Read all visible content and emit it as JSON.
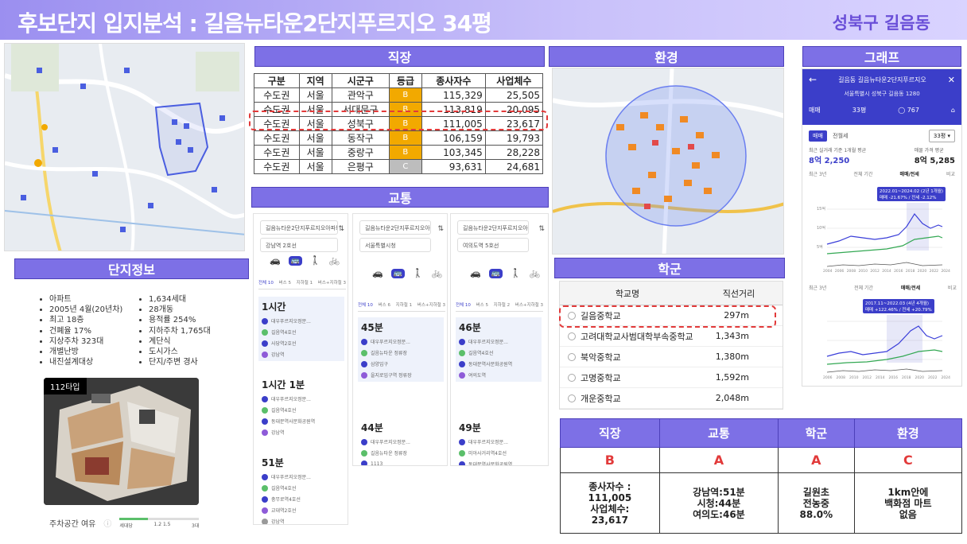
{
  "header": {
    "title": "후보단지 입지분석 : 길음뉴타운2단지푸르지오 34평",
    "region": "성북구 길음동"
  },
  "sections": {
    "jobs": "직장",
    "env": "환경",
    "graph": "그래프",
    "transport": "교통",
    "complex": "단지정보",
    "school": "학군"
  },
  "jobs_table": {
    "headers": [
      "구분",
      "지역",
      "시군구",
      "등급",
      "종사자수",
      "사업체수"
    ],
    "rows": [
      [
        "수도권",
        "서울",
        "관악구",
        "B",
        "115,329",
        "25,505"
      ],
      [
        "수도권",
        "서울",
        "서대문구",
        "B",
        "113,819",
        "20,095"
      ],
      [
        "수도권",
        "서울",
        "성북구",
        "B",
        "111,005",
        "23,617"
      ],
      [
        "수도권",
        "서울",
        "동작구",
        "B",
        "106,159",
        "19,793"
      ],
      [
        "수도권",
        "서울",
        "중랑구",
        "B",
        "103,345",
        "28,228"
      ],
      [
        "수도권",
        "서울",
        "은평구",
        "C",
        "93,631",
        "24,681"
      ]
    ],
    "grade_colors": {
      "B": "#f2a900",
      "C": "#bdbdbd"
    }
  },
  "transport": {
    "columns": [
      {
        "from": "길음뉴타운2단지푸르지오아파트",
        "to": "강남역 2호선",
        "tabs": [
          "전체 10",
          "버스 5",
          "지하철 1",
          "버스+지하철 3"
        ],
        "routes": [
          {
            "time": "1시간",
            "stops": [
              "대우푸르지오정문...",
              "길음역4호선",
              "사당역2호선",
              "강남역"
            ]
          },
          {
            "time": "1시간 1분",
            "stops": [
              "대우푸르지오정문...",
              "길음역4호선",
              "동대문역사문화공원역",
              "강남역"
            ]
          },
          {
            "time": "51분",
            "stops": [
              "대우푸르지오정문...",
              "길음역4호선",
              "충무로역4호선",
              "교대역2호선",
              "강남역"
            ]
          }
        ]
      },
      {
        "from": "길음뉴타운2단지푸르지오아파트",
        "to": "서울특별시청",
        "tabs": [
          "전체 10",
          "버스 6",
          "지하철 1",
          "버스+지하철 3"
        ],
        "routes": [
          {
            "time": "45분",
            "stops": [
              "대우푸르지오정문...",
              "길음뉴타운 정류장",
              "삼양입구",
              "을지로입구역 정류장"
            ]
          },
          {
            "time": "44분",
            "stops": [
              "대우푸르지오정문...",
              "길음뉴타운 정류장",
              "1113",
              "을지로입구역 정류장"
            ]
          }
        ]
      },
      {
        "from": "길음뉴타운2단지푸르지오아파트",
        "to": "여의도역 5호선",
        "tabs": [
          "전체 10",
          "버스 5",
          "지하철 2",
          "버스+지하철 3"
        ],
        "routes": [
          {
            "time": "46분",
            "stops": [
              "대우푸르지오정문...",
              "길음역4호선",
              "동대문역사문화공원역",
              "여의도역"
            ]
          },
          {
            "time": "49분",
            "stops": [
              "대우푸르지오정문...",
              "미아사거리역4호선",
              "동대문역사문화공원역",
              "여의도역"
            ]
          }
        ]
      }
    ]
  },
  "complex_info": {
    "left": [
      "아파트",
      "2005년 4월(20년차)",
      "최고 18층",
      "건폐율 17%",
      "지상주차 323대",
      "개별난방",
      "내진설계대상"
    ],
    "right": [
      "1,634세대",
      "28개동",
      "용적률 254%",
      "지하주차 1,765대",
      "계단식",
      "도시가스",
      "단지/주변 경사"
    ],
    "floorplan_tag": "112타입",
    "parking_label": "주차공간 여유",
    "parking_scale": [
      "세대당",
      "1.2 1.5",
      "3대"
    ],
    "parking_ratio": 1.08
  },
  "schools": {
    "headers": [
      "학교명",
      "직선거리"
    ],
    "rows": [
      [
        "길음중학교",
        "297m"
      ],
      [
        "고려대학교사범대학부속중학교",
        "1,343m"
      ],
      [
        "북악중학교",
        "1,380m"
      ],
      [
        "고명중학교",
        "1,592m"
      ],
      [
        "개운중학교",
        "2,048m"
      ]
    ]
  },
  "graph": {
    "title": "길음동 길음뉴타운2단지푸르지오",
    "address": "서울특별시 성북구 길음동 1280",
    "filters": [
      "매매",
      "33평",
      "767"
    ],
    "tabs": [
      "매매",
      "전월세"
    ],
    "size": "33평",
    "recent_label": "최근 실거래 기준 1개월 평균",
    "recent_value": "8억 2,250",
    "ask_label": "매물 가격 평균",
    "ask_value": "8억 5,285",
    "period_tabs": [
      "최근 3년",
      "전체 기간",
      "매매/전세",
      "비교"
    ],
    "tooltip1": "2022.01~2024.02 (2년 1개월)",
    "tooltip1_sub": "매매 -21.67% / 전세 -2.12%",
    "tooltip2": "2017.11~2022.03 (4년 4개월)",
    "tooltip2_sub": "매매 +122.46% / 전세 +20.79%",
    "years1": [
      "2004",
      "2006",
      "2008",
      "2010",
      "2012",
      "2014",
      "2016",
      "2018",
      "2020",
      "2022",
      "2024"
    ],
    "years2": [
      "2006",
      "2008",
      "2010",
      "2012",
      "2014",
      "2016",
      "2018",
      "2020",
      "2022",
      "2024"
    ],
    "y_labels": [
      "15억",
      "10억",
      "5억"
    ],
    "colors": {
      "sale": "#3a3ed9",
      "jeonse": "#33a853",
      "volume": "#555555",
      "header": "#3b3ec9"
    }
  },
  "summary": {
    "headers": [
      "직장",
      "교통",
      "학군",
      "환경"
    ],
    "grades": [
      "B",
      "A",
      "A",
      "C"
    ],
    "desc": [
      [
        "종사자수 :",
        "111,005",
        "사업체수:",
        "23,617"
      ],
      [
        "강남역:51분",
        "시청:44분",
        "여의도:46분"
      ],
      [
        "길원초",
        "전농중",
        "88.0%"
      ],
      [
        "1km안에",
        "백화점 마트",
        "없음"
      ]
    ]
  }
}
